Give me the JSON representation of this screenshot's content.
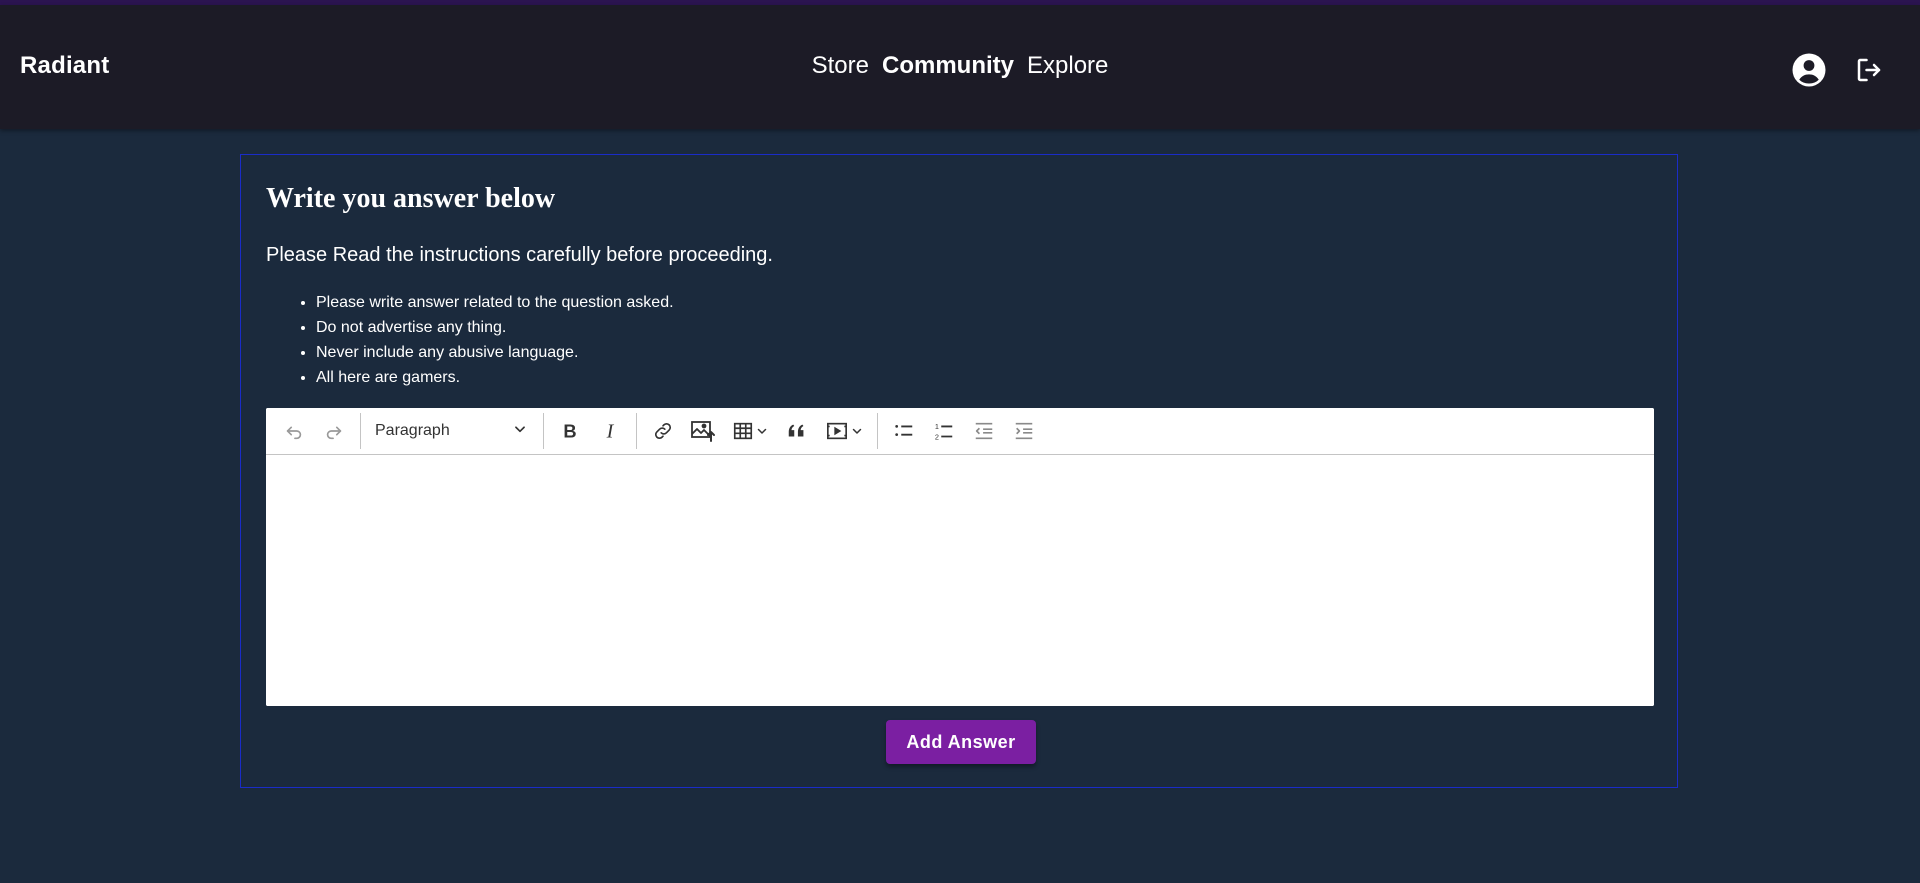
{
  "header": {
    "brand": "Radiant",
    "nav": [
      "Store",
      "Community",
      "Explore"
    ],
    "active_nav": "Community",
    "icons": [
      "account-circle-icon",
      "logout-icon"
    ]
  },
  "form": {
    "title": "Write you answer below",
    "subtitle": "Please Read the instructions carefully before proceeding.",
    "instructions": [
      "Please write answer related to the question asked.",
      "Do not advertise any thing.",
      "Never include any abusive language.",
      "All here are gamers."
    ],
    "editor": {
      "heading_select": "Paragraph",
      "content": "",
      "toolbar_icons": [
        "undo-icon",
        "redo-icon",
        "bold-icon",
        "italic-icon",
        "link-icon",
        "image-upload-icon",
        "table-icon",
        "blockquote-icon",
        "media-embed-icon",
        "bulleted-list-icon",
        "numbered-list-icon",
        "outdent-icon",
        "indent-icon"
      ]
    },
    "submit_label": "Add Answer"
  },
  "colors": {
    "page_background": "#1b2a3d",
    "navbar_background": "#1c1b26",
    "card_border": "#1a2cc8",
    "button": "#7b1fa2"
  }
}
